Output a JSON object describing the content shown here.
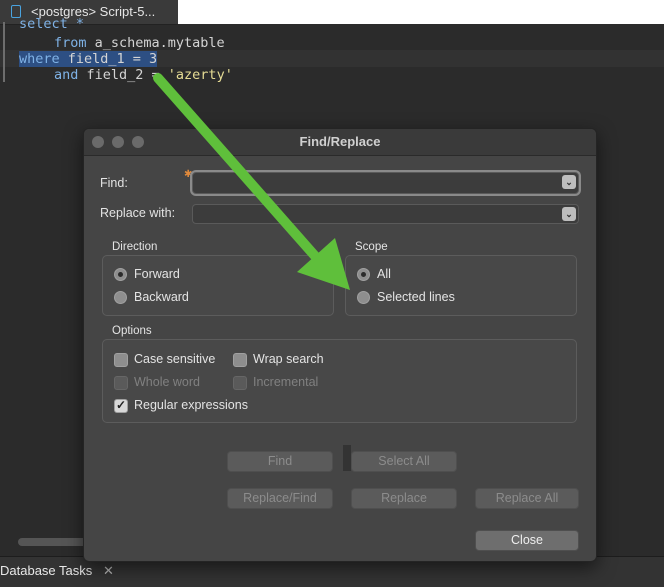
{
  "editor": {
    "tab_label": "<postgres> Script-5...",
    "code_lines": {
      "l0": "select *",
      "l1_kw": "from",
      "l1_rest": " a_schema.mytable",
      "l2_kw": "where",
      "l2_rest": " field_1 = 3",
      "l3_kw": "and",
      "l3_mid": " field_2 = ",
      "l3_str": "'azerty'"
    }
  },
  "bottom": {
    "tab_label": "Database Tasks",
    "close_glyph": "✕"
  },
  "dialog": {
    "title": "Find/Replace",
    "find_label": "Find:",
    "find_value": "",
    "replace_label": "Replace with:",
    "replace_value": "",
    "direction": {
      "title": "Direction",
      "forward": "Forward",
      "backward": "Backward",
      "selected": "Forward"
    },
    "scope": {
      "title": "Scope",
      "all": "All",
      "selected_lines": "Selected lines",
      "selected": "All"
    },
    "options": {
      "title": "Options",
      "case_sensitive": "Case sensitive",
      "wrap_search": "Wrap search",
      "whole_word": "Whole word",
      "incremental": "Incremental",
      "regular_expressions": "Regular expressions",
      "checked": [
        "Regular expressions"
      ]
    },
    "buttons": {
      "find": "Find",
      "select_all": "Select All",
      "replace_find": "Replace/Find",
      "replace": "Replace",
      "replace_all": "Replace All",
      "close": "Close"
    }
  },
  "annotation": {
    "arrow_color": "#5fbf3b"
  }
}
